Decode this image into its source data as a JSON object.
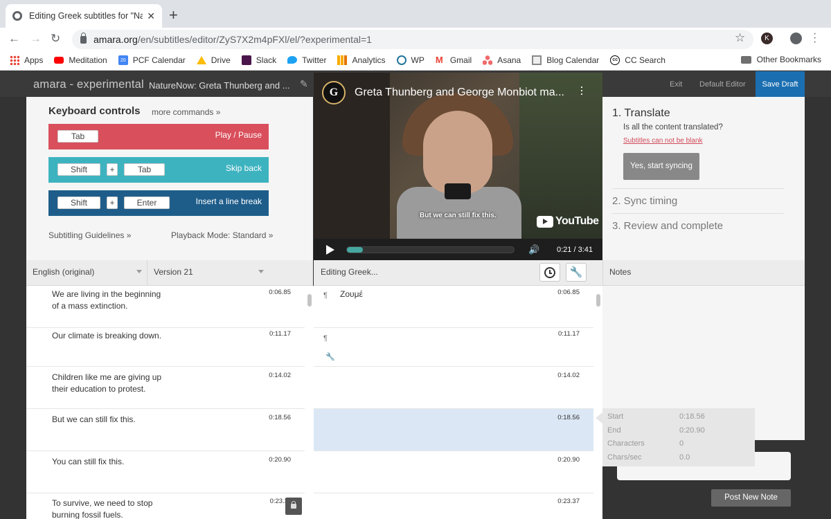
{
  "browser": {
    "tab_title": "Editing Greek subtitles for \"Na",
    "url_host": "amara.org",
    "url_path": "/en/subtitles/editor/ZyS7X2m4pFXl/el/?experimental=1",
    "profile_initial": "K",
    "bookmarks": [
      "Apps",
      "Meditation",
      "PCF Calendar",
      "Drive",
      "Slack",
      "Twitter",
      "Analytics",
      "WP",
      "Gmail",
      "Asana",
      "Blog Calendar",
      "CC Search"
    ],
    "other_bookmarks": "Other Bookmarks",
    "calendar_day": "20"
  },
  "app": {
    "logo": "amara - experimental",
    "video_title": "NatureNow: Greta Thunberg and ...",
    "exit": "Exit",
    "default_editor": "Default Editor",
    "save_draft": "Save Draft"
  },
  "keyboard": {
    "title": "Keyboard controls",
    "more": "more commands »",
    "rows": [
      {
        "keys": [
          "Tab"
        ],
        "label": "Play / Pause"
      },
      {
        "keys": [
          "Shift",
          "+",
          "Tab"
        ],
        "label": "Skip back"
      },
      {
        "keys": [
          "Shift",
          "+",
          "Enter"
        ],
        "label": "Insert a line break"
      }
    ],
    "guidelines": "Subtitling Guidelines »",
    "playback_mode": "Playback Mode: Standard »"
  },
  "video": {
    "channel_initial": "G",
    "title": "Greta Thunberg and George Monbiot ma...",
    "caption": "But we can still fix this.",
    "youtube": "YouTube",
    "time": "0:21 / 3:41",
    "progress": 0.095
  },
  "steps": {
    "step1": "1. Translate",
    "question": "Is all the content translated?",
    "warning": "Subtitles can not be blank",
    "sync_button": "Yes, start syncing",
    "step2": "2. Sync timing",
    "step3": "3. Review and complete"
  },
  "headers": {
    "language": "English (original)",
    "version": "Version 21",
    "editing": "Editing Greek...",
    "notes": "Notes"
  },
  "original_rows": [
    {
      "text": "We are living in the beginning of a mass extinction.",
      "time": "0:06.85"
    },
    {
      "text": "Our climate is breaking down.",
      "time": "0:11.17"
    },
    {
      "text": "Children like me are giving up their education to protest.",
      "time": "0:14.02"
    },
    {
      "text": "But we can still fix this.",
      "time": "0:18.56"
    },
    {
      "text": "You can still fix this.",
      "time": "0:20.90"
    },
    {
      "text": "To survive, we need to stop burning fossil fuels.",
      "time": "0:23.3"
    }
  ],
  "edit_rows": [
    {
      "text": "Ζουμέ",
      "time": "0:06.85"
    },
    {
      "text": "",
      "time": "0:11.17"
    },
    {
      "text": "",
      "time": "0:14.02"
    },
    {
      "text": "",
      "time": "0:18.56"
    },
    {
      "text": "",
      "time": "0:20.90"
    },
    {
      "text": "",
      "time": "0:23.37"
    }
  ],
  "timing_popover": {
    "start_label": "Start",
    "start": "0:18.56",
    "end_label": "End",
    "end": "0:20.90",
    "chars_label": "Characters",
    "chars": "0",
    "cps_label": "Chars/sec",
    "cps": "0.0"
  },
  "notes": {
    "post_button": "Post New Note"
  },
  "colors": {
    "play_pause": "#d94f5c",
    "skip_back": "#3eb3c0",
    "line_break": "#1e5d8a",
    "save_draft": "#1b6fb1",
    "selected_row": "#dbe7f5"
  }
}
